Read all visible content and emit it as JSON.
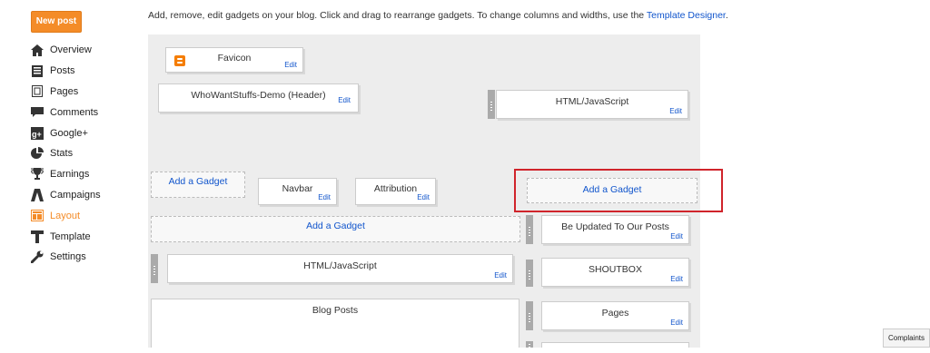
{
  "header": {
    "new_post_label": "New post"
  },
  "sidebar": {
    "items": [
      {
        "label": "Overview",
        "icon": "home-icon"
      },
      {
        "label": "Posts",
        "icon": "posts-icon"
      },
      {
        "label": "Pages",
        "icon": "pages-icon"
      },
      {
        "label": "Comments",
        "icon": "comment-icon"
      },
      {
        "label": "Google+",
        "icon": "google-plus-icon"
      },
      {
        "label": "Stats",
        "icon": "pie-chart-icon"
      },
      {
        "label": "Earnings",
        "icon": "trophy-icon"
      },
      {
        "label": "Campaigns",
        "icon": "campaigns-icon"
      },
      {
        "label": "Layout",
        "icon": "layout-icon",
        "active": true
      },
      {
        "label": "Template",
        "icon": "template-icon"
      },
      {
        "label": "Settings",
        "icon": "wrench-icon"
      }
    ],
    "accent": "#f48c28"
  },
  "intro": {
    "text": "Add, remove, edit gadgets on your blog. Click and drag to rearrange gadgets. To change columns and widths, use the ",
    "link": "Template Designer",
    "end": "."
  },
  "layout": {
    "favicon": {
      "title": "Favicon",
      "edit": "Edit"
    },
    "header": {
      "title": "WhoWantStuffs-Demo (Header)",
      "edit": "Edit"
    },
    "html_top": {
      "title": "HTML/JavaScript",
      "edit": "Edit"
    },
    "add_left": "Add a Gadget",
    "navbar": {
      "title": "Navbar",
      "edit": "Edit"
    },
    "attribution": {
      "title": "Attribution",
      "edit": "Edit"
    },
    "add_right_top": "Add a Gadget",
    "add_main": "Add a Gadget",
    "be_updated": {
      "title": "Be Updated To Our Posts",
      "edit": "Edit"
    },
    "html_main": {
      "title": "HTML/JavaScript",
      "edit": "Edit"
    },
    "shoutbox": {
      "title": "SHOUTBOX",
      "edit": "Edit"
    },
    "blog_posts": {
      "title": "Blog Posts"
    },
    "pages": {
      "title": "Pages",
      "edit": "Edit"
    }
  },
  "footer": {
    "complaints": "Complaints"
  },
  "colors": {
    "link": "#1155cc",
    "highlight": "#d0242b",
    "canvas": "#ededed"
  }
}
